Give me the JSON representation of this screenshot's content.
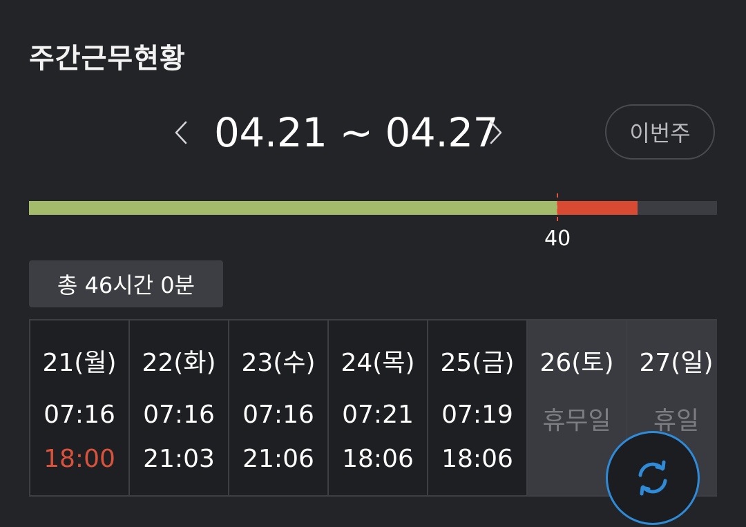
{
  "header": {
    "title": "주간근무현황"
  },
  "week_nav": {
    "range": "04.21 ~ 04.27",
    "this_week_label": "이번주"
  },
  "progress": {
    "worked_hours": 46,
    "threshold_hours": 40,
    "threshold_label": "40",
    "colors": {
      "normal": "#a3bb6a",
      "overtime": "#d94a32",
      "track": "#3c3d42"
    }
  },
  "summary": {
    "total_label": "총 46시간 0분"
  },
  "days": [
    {
      "label": "21(월)",
      "in": "07:16",
      "out": "18:00",
      "out_late": true,
      "off": false,
      "status": ""
    },
    {
      "label": "22(화)",
      "in": "07:16",
      "out": "21:03",
      "out_late": false,
      "off": false,
      "status": ""
    },
    {
      "label": "23(수)",
      "in": "07:16",
      "out": "21:06",
      "out_late": false,
      "off": false,
      "status": ""
    },
    {
      "label": "24(목)",
      "in": "07:21",
      "out": "18:06",
      "out_late": false,
      "off": false,
      "status": ""
    },
    {
      "label": "25(금)",
      "in": "07:19",
      "out": "18:06",
      "out_late": false,
      "off": false,
      "status": ""
    },
    {
      "label": "26(토)",
      "in": "",
      "out": "",
      "out_late": false,
      "off": true,
      "status": "휴무일"
    },
    {
      "label": "27(일)",
      "in": "",
      "out": "",
      "out_late": false,
      "off": true,
      "status": "휴일"
    }
  ],
  "icons": {
    "prev": "chevron-left-icon",
    "next": "chevron-right-icon",
    "refresh": "refresh-icon"
  },
  "accent_color": "#2f8bd7"
}
